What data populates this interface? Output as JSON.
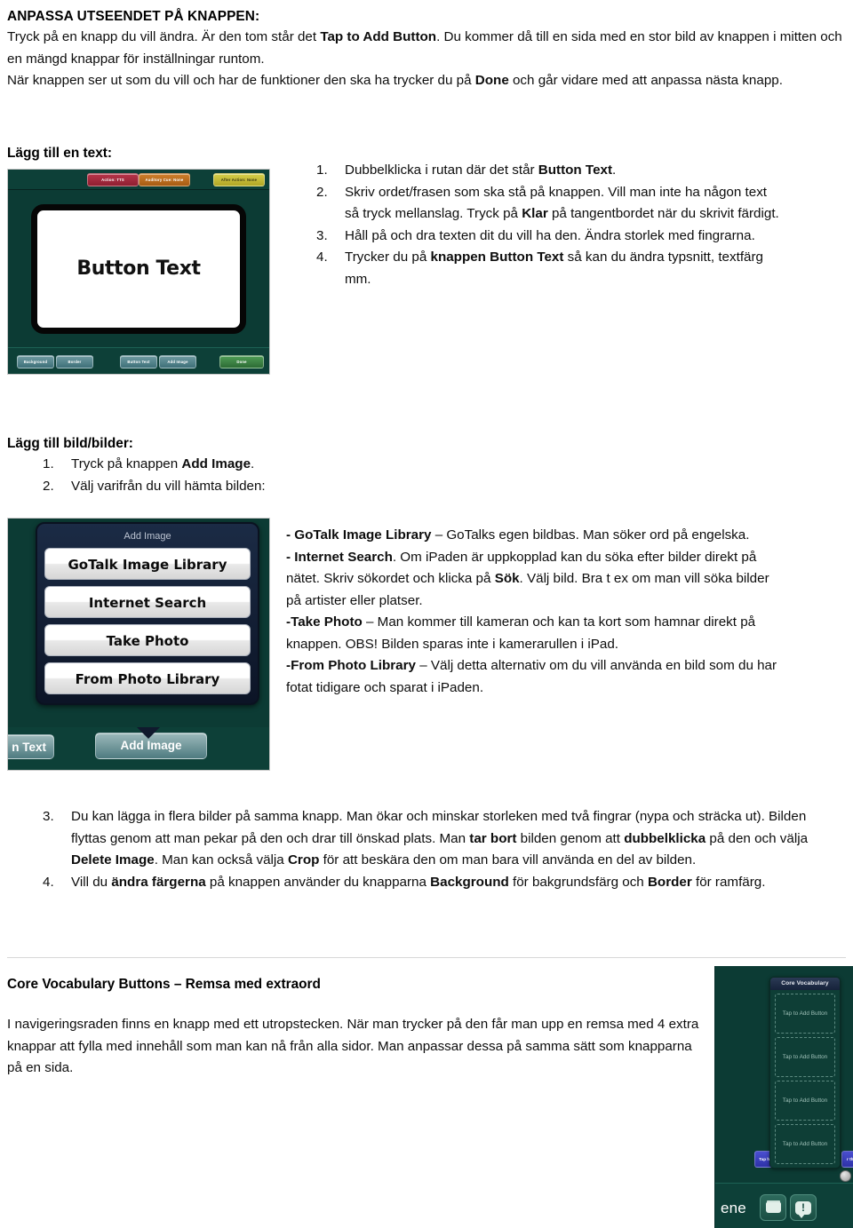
{
  "document": {
    "intro": {
      "heading": "ANPASSA UTSEENDET PÅ KNAPPEN:",
      "p1_a": "Tryck på en knapp du vill ändra. Är den tom står det ",
      "p1_b": "Tap to Add Button",
      "p1_c": ". Du kommer då till en sida med en stor bild av knappen i mitten och en mängd knappar för inställningar runtom.",
      "p2_a": "När knappen ser ut som du vill och har de funktioner den ska ha trycker du på ",
      "p2_b": "Done",
      "p2_c": " och går vidare med att anpassa nästa knapp."
    },
    "text_section": {
      "heading": "Lägg till en text:",
      "steps": [
        {
          "n": "1.",
          "a": "Dubbelklicka i rutan där det står ",
          "b": "Button Text",
          "c": "."
        },
        {
          "n": "2.",
          "a": "Skriv ordet/frasen som ska stå på knappen. Vill man inte ha någon text så tryck mellanslag. Tryck på ",
          "b": "Klar",
          "c": " på tangentbordet när du skrivit färdigt."
        },
        {
          "n": "3.",
          "a": "Håll på och dra texten dit du vill ha den. Ändra storlek med fingrarna.",
          "b": "",
          "c": ""
        },
        {
          "n": "4.",
          "a": "Trycker du på ",
          "b": "knappen Button Text",
          "c": " så kan du ändra typsnitt, textfärg mm."
        }
      ]
    },
    "button_editor_screenshot": {
      "canvas_label": "Button Text",
      "top_buttons": [
        {
          "label": "Action: TTS",
          "color": "#a32940"
        },
        {
          "label": "Auditory Cue: None",
          "color": "#c0781f"
        },
        {
          "label": "After Action: None",
          "color": "#c9c23b"
        }
      ],
      "bottom_buttons": [
        {
          "label": "Background"
        },
        {
          "label": "Border"
        },
        {
          "label": "Button Text"
        },
        {
          "label": "Add Image"
        }
      ],
      "done_label": "Done",
      "accent_green": "#0c3b34"
    },
    "image_section": {
      "heading": "Lägg till bild/bilder:",
      "steps": [
        {
          "n": "1.",
          "a": "Tryck på knappen ",
          "b": "Add Image",
          "c": "."
        },
        {
          "n": "2.",
          "a": "Välj varifrån du vill hämta bilden:",
          "b": "",
          "c": ""
        }
      ]
    },
    "add_image_screenshot": {
      "popover_title": "Add Image",
      "options": [
        "GoTalk Image Library",
        "Internet Search",
        "Take Photo",
        "From Photo Library"
      ],
      "strip_left_label": "n Text",
      "strip_right_label": "Add Image"
    },
    "image_descriptions": [
      {
        "dash": "- ",
        "bold": "GoTalk Image Library",
        "rest": " – GoTalks egen bildbas. Man söker ord på engelska."
      },
      {
        "dash": "- ",
        "bold": "Internet Search",
        "rest": ". Om iPaden är uppkopplad kan du söka efter bilder direkt på nätet. Skriv sökordet och klicka på ",
        "bold2": "Sök",
        "rest2": ". Välj bild. Bra t ex om man vill söka bilder på artister eller platser."
      },
      {
        "dash": "-",
        "bold": "Take Photo",
        "rest": " – Man kommer till kameran och kan ta kort som hamnar direkt på knappen. OBS! Bilden sparas inte i kamerarullen i iPad."
      },
      {
        "dash": "-",
        "bold": "From Photo Library",
        "rest": " – Välj detta alternativ om du vill använda en bild som du har fotat tidigare och sparat i iPaden."
      }
    ],
    "lower_steps": [
      {
        "n": "3.",
        "seg": [
          {
            "t": "Du kan lägga in flera bilder på samma knapp. Man ökar och minskar storleken med två fingrar (nypa och sträcka ut). Bilden flyttas genom att man pekar på den och drar till önskad plats. Man ",
            "bold": false
          },
          {
            "t": "tar bort",
            "bold": true
          },
          {
            "t": " bilden genom att ",
            "bold": false
          },
          {
            "t": "dubbelklicka",
            "bold": true
          },
          {
            "t": " på den och välja ",
            "bold": false
          },
          {
            "t": "Delete Image",
            "bold": true
          },
          {
            "t": ". Man kan också välja ",
            "bold": false
          },
          {
            "t": "Crop",
            "bold": true
          },
          {
            "t": " för att beskära den om man bara vill använda en del av bilden.",
            "bold": false
          }
        ]
      },
      {
        "n": "4.",
        "seg": [
          {
            "t": "Vill du ",
            "bold": false
          },
          {
            "t": "ändra färgerna",
            "bold": true
          },
          {
            "t": " på knappen använder du knapparna ",
            "bold": false
          },
          {
            "t": "Background",
            "bold": true
          },
          {
            "t": " för bakgrundsfärg och ",
            "bold": false
          },
          {
            "t": "Border",
            "bold": true
          },
          {
            "t": " för ramfärg.",
            "bold": false
          }
        ]
      }
    ],
    "core_section": {
      "heading": "Core Vocabulary Buttons – Remsa med extraord",
      "body": "I navigeringsraden finns en knapp med ett utropstecken. När man trycker på den får man upp en remsa med 4 extra knappar att fylla med innehåll som man kan nå från alla sidor. Man anpassar dessa på samma sätt som knapparna på en sida."
    },
    "core_screenshot": {
      "popover_title": "Core Vocabulary",
      "slots": [
        "Tap to Add Button",
        "Tap to Add Button",
        "Tap to Add Button",
        "Tap to Add Button"
      ],
      "pill_left": "Tap here t",
      "pill_right": "r the",
      "page_name": "ene",
      "nav_icons": [
        "folder-icon",
        "speech-bubble-exclamation-icon"
      ]
    }
  }
}
